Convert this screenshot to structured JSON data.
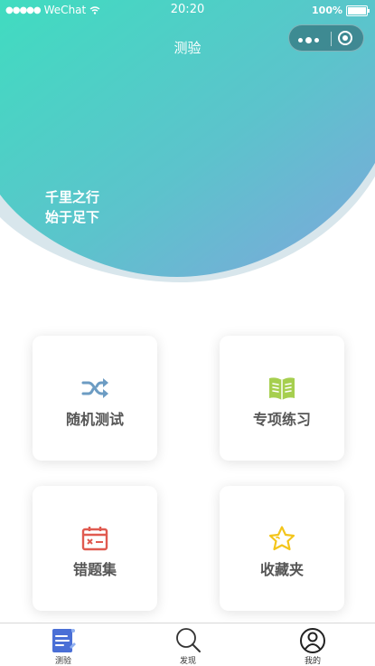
{
  "status_bar": {
    "carrier": "WeChat",
    "time": "20:20",
    "battery": "100%"
  },
  "nav": {
    "title": "测验"
  },
  "hero": {
    "line1": "千里之行",
    "line2": "始于足下"
  },
  "cards": [
    {
      "label": "随机测试",
      "icon": "shuffle-icon",
      "color": "#6c9cc3"
    },
    {
      "label": "专项练习",
      "icon": "book-icon",
      "color": "#a6cf4f"
    },
    {
      "label": "错题集",
      "icon": "calendar-error-icon",
      "color": "#e05a50"
    },
    {
      "label": "收藏夹",
      "icon": "star-icon",
      "color": "#f3c51b"
    }
  ],
  "tabs": [
    {
      "label": "测验",
      "icon": "quiz-document-icon",
      "active": true
    },
    {
      "label": "发现",
      "icon": "search-icon",
      "active": false
    },
    {
      "label": "我的",
      "icon": "user-icon",
      "active": false
    }
  ],
  "colors": {
    "gradient_start": "#3fd8c0",
    "gradient_end": "#76a8dd",
    "accent": "#4a6fd6"
  }
}
